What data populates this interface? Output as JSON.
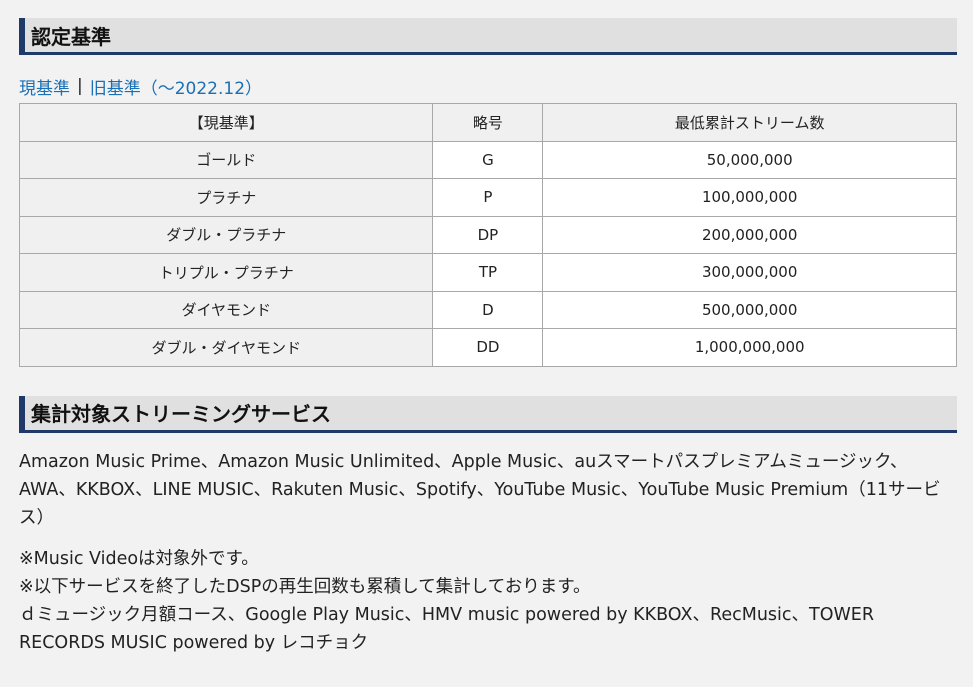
{
  "section1": {
    "title": "認定基準"
  },
  "tabs": {
    "current": "現基準",
    "separator": "|",
    "old": "旧基準（～2022.12）"
  },
  "table": {
    "headers": [
      "【現基準】",
      "略号",
      "最低累計ストリーム数"
    ],
    "rows": [
      {
        "level": "ゴールド",
        "code": "G",
        "streams": "50,000,000"
      },
      {
        "level": "プラチナ",
        "code": "P",
        "streams": "100,000,000"
      },
      {
        "level": "ダブル・プラチナ",
        "code": "DP",
        "streams": "200,000,000"
      },
      {
        "level": "トリプル・プラチナ",
        "code": "TP",
        "streams": "300,000,000"
      },
      {
        "level": "ダイヤモンド",
        "code": "D",
        "streams": "500,000,000"
      },
      {
        "level": "ダブル・ダイヤモンド",
        "code": "DD",
        "streams": "1,000,000,000"
      }
    ]
  },
  "section2": {
    "title": "集計対象ストリーミングサービス",
    "services": "Amazon Music Prime、Amazon Music Unlimited、Apple Music、auスマートパスプレミアムミュージック、AWA、KKBOX、LINE MUSIC、Rakuten Music、Spotify、YouTube Music、YouTube Music Premium（11サービス）",
    "notes": [
      "※Music Videoは対象外です。",
      "※以下サービスを終了したDSPの再生回数も累積して集計しております。",
      "ｄミュージック月額コース、Google Play Music、HMV music powered by KKBOX、RecMusic、TOWER RECORDS MUSIC powered by レコチョク"
    ]
  },
  "colors": {
    "accent": "#1f3a68",
    "link": "#1a6fb5",
    "background": "#f2f2f2"
  }
}
